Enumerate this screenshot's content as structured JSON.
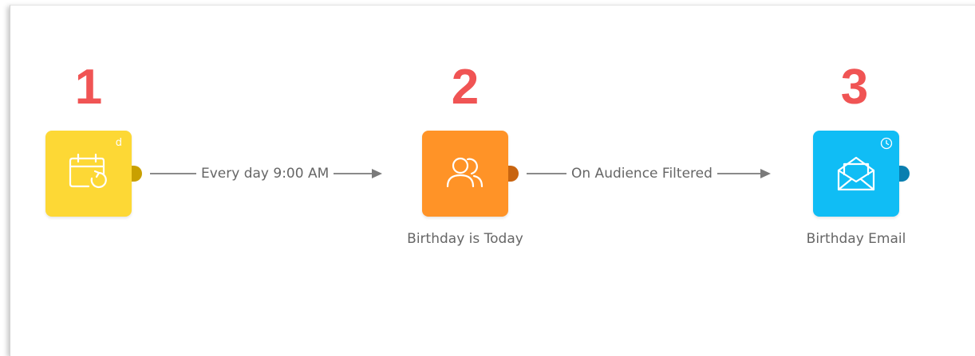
{
  "workflow": {
    "steps": [
      {
        "number": "1",
        "badge": "d",
        "icon": "calendar-repeat-icon",
        "color": "#FDD835",
        "port_color": "#C9A000",
        "caption": ""
      },
      {
        "number": "2",
        "badge": "",
        "icon": "audience-users-icon",
        "color": "#FF9327",
        "port_color": "#C86410",
        "caption": "Birthday is Today"
      },
      {
        "number": "3",
        "badge": "clock-icon",
        "icon": "email-open-icon",
        "color": "#10BDF5",
        "port_color": "#0A7FB0",
        "caption": "Birthday Email"
      }
    ],
    "connectors": [
      {
        "label": "Every day 9:00 AM"
      },
      {
        "label": "On Audience Filtered"
      }
    ],
    "step_number_color": "#F05454",
    "connector_color": "#8A8A8A"
  }
}
